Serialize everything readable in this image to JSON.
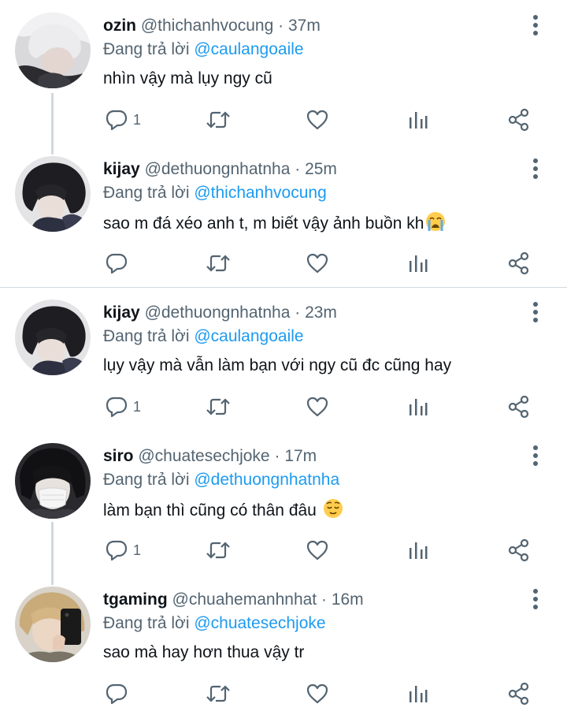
{
  "colors": {
    "accent": "#1d9bf0",
    "secondary_text": "#536471",
    "primary_text": "#0f1419",
    "divider": "#cfd9de"
  },
  "tweets": [
    {
      "name": "ozin",
      "handle": "@thichanhvocung",
      "dot": "·",
      "time": "37m",
      "replying_label": "Đang trả lời",
      "replying_to": "@caulangoaile",
      "text": "nhìn vậy mà lụy ngy cũ",
      "reply_count": "1",
      "avatar": "avatar-white-hair",
      "emoji": ""
    },
    {
      "name": "kijay",
      "handle": "@dethuongnhatnha",
      "dot": "·",
      "time": "25m",
      "replying_label": "Đang trả lời",
      "replying_to": "@thichanhvocung",
      "text": "sao m đá xéo anh t, m biết vậy ảnh buồn kh",
      "reply_count": "",
      "avatar": "avatar-dark-hair",
      "emoji": "crying-face-emoji"
    },
    {
      "name": "kijay",
      "handle": "@dethuongnhatnha",
      "dot": "·",
      "time": "23m",
      "replying_label": "Đang trả lời",
      "replying_to": "@caulangoaile",
      "text": "lụy vậy mà vẫn làm bạn với ngy cũ đc cũng hay",
      "reply_count": "1",
      "avatar": "avatar-dark-hair",
      "emoji": ""
    },
    {
      "name": "siro",
      "handle": "@chuatesechjoke",
      "dot": "·",
      "time": "17m",
      "replying_label": "Đang trả lời",
      "replying_to": "@dethuongnhatnha",
      "text": "làm bạn thì cũng có thân đâu",
      "reply_count": "1",
      "avatar": "avatar-mask",
      "emoji": "relieved-face-emoji"
    },
    {
      "name": "tgaming",
      "handle": "@chuahemanhnhat",
      "dot": "·",
      "time": "16m",
      "replying_label": "Đang trả lời",
      "replying_to": "@chuatesechjoke",
      "text": "sao mà hay hơn thua vậy tr",
      "reply_count": "",
      "avatar": "avatar-blond-phone",
      "emoji": ""
    }
  ],
  "icons": {
    "reply": "reply-icon",
    "retweet": "retweet-icon",
    "like": "heart-icon",
    "views": "analytics-icon",
    "share": "share-icon",
    "more": "more-vertical-icon"
  }
}
